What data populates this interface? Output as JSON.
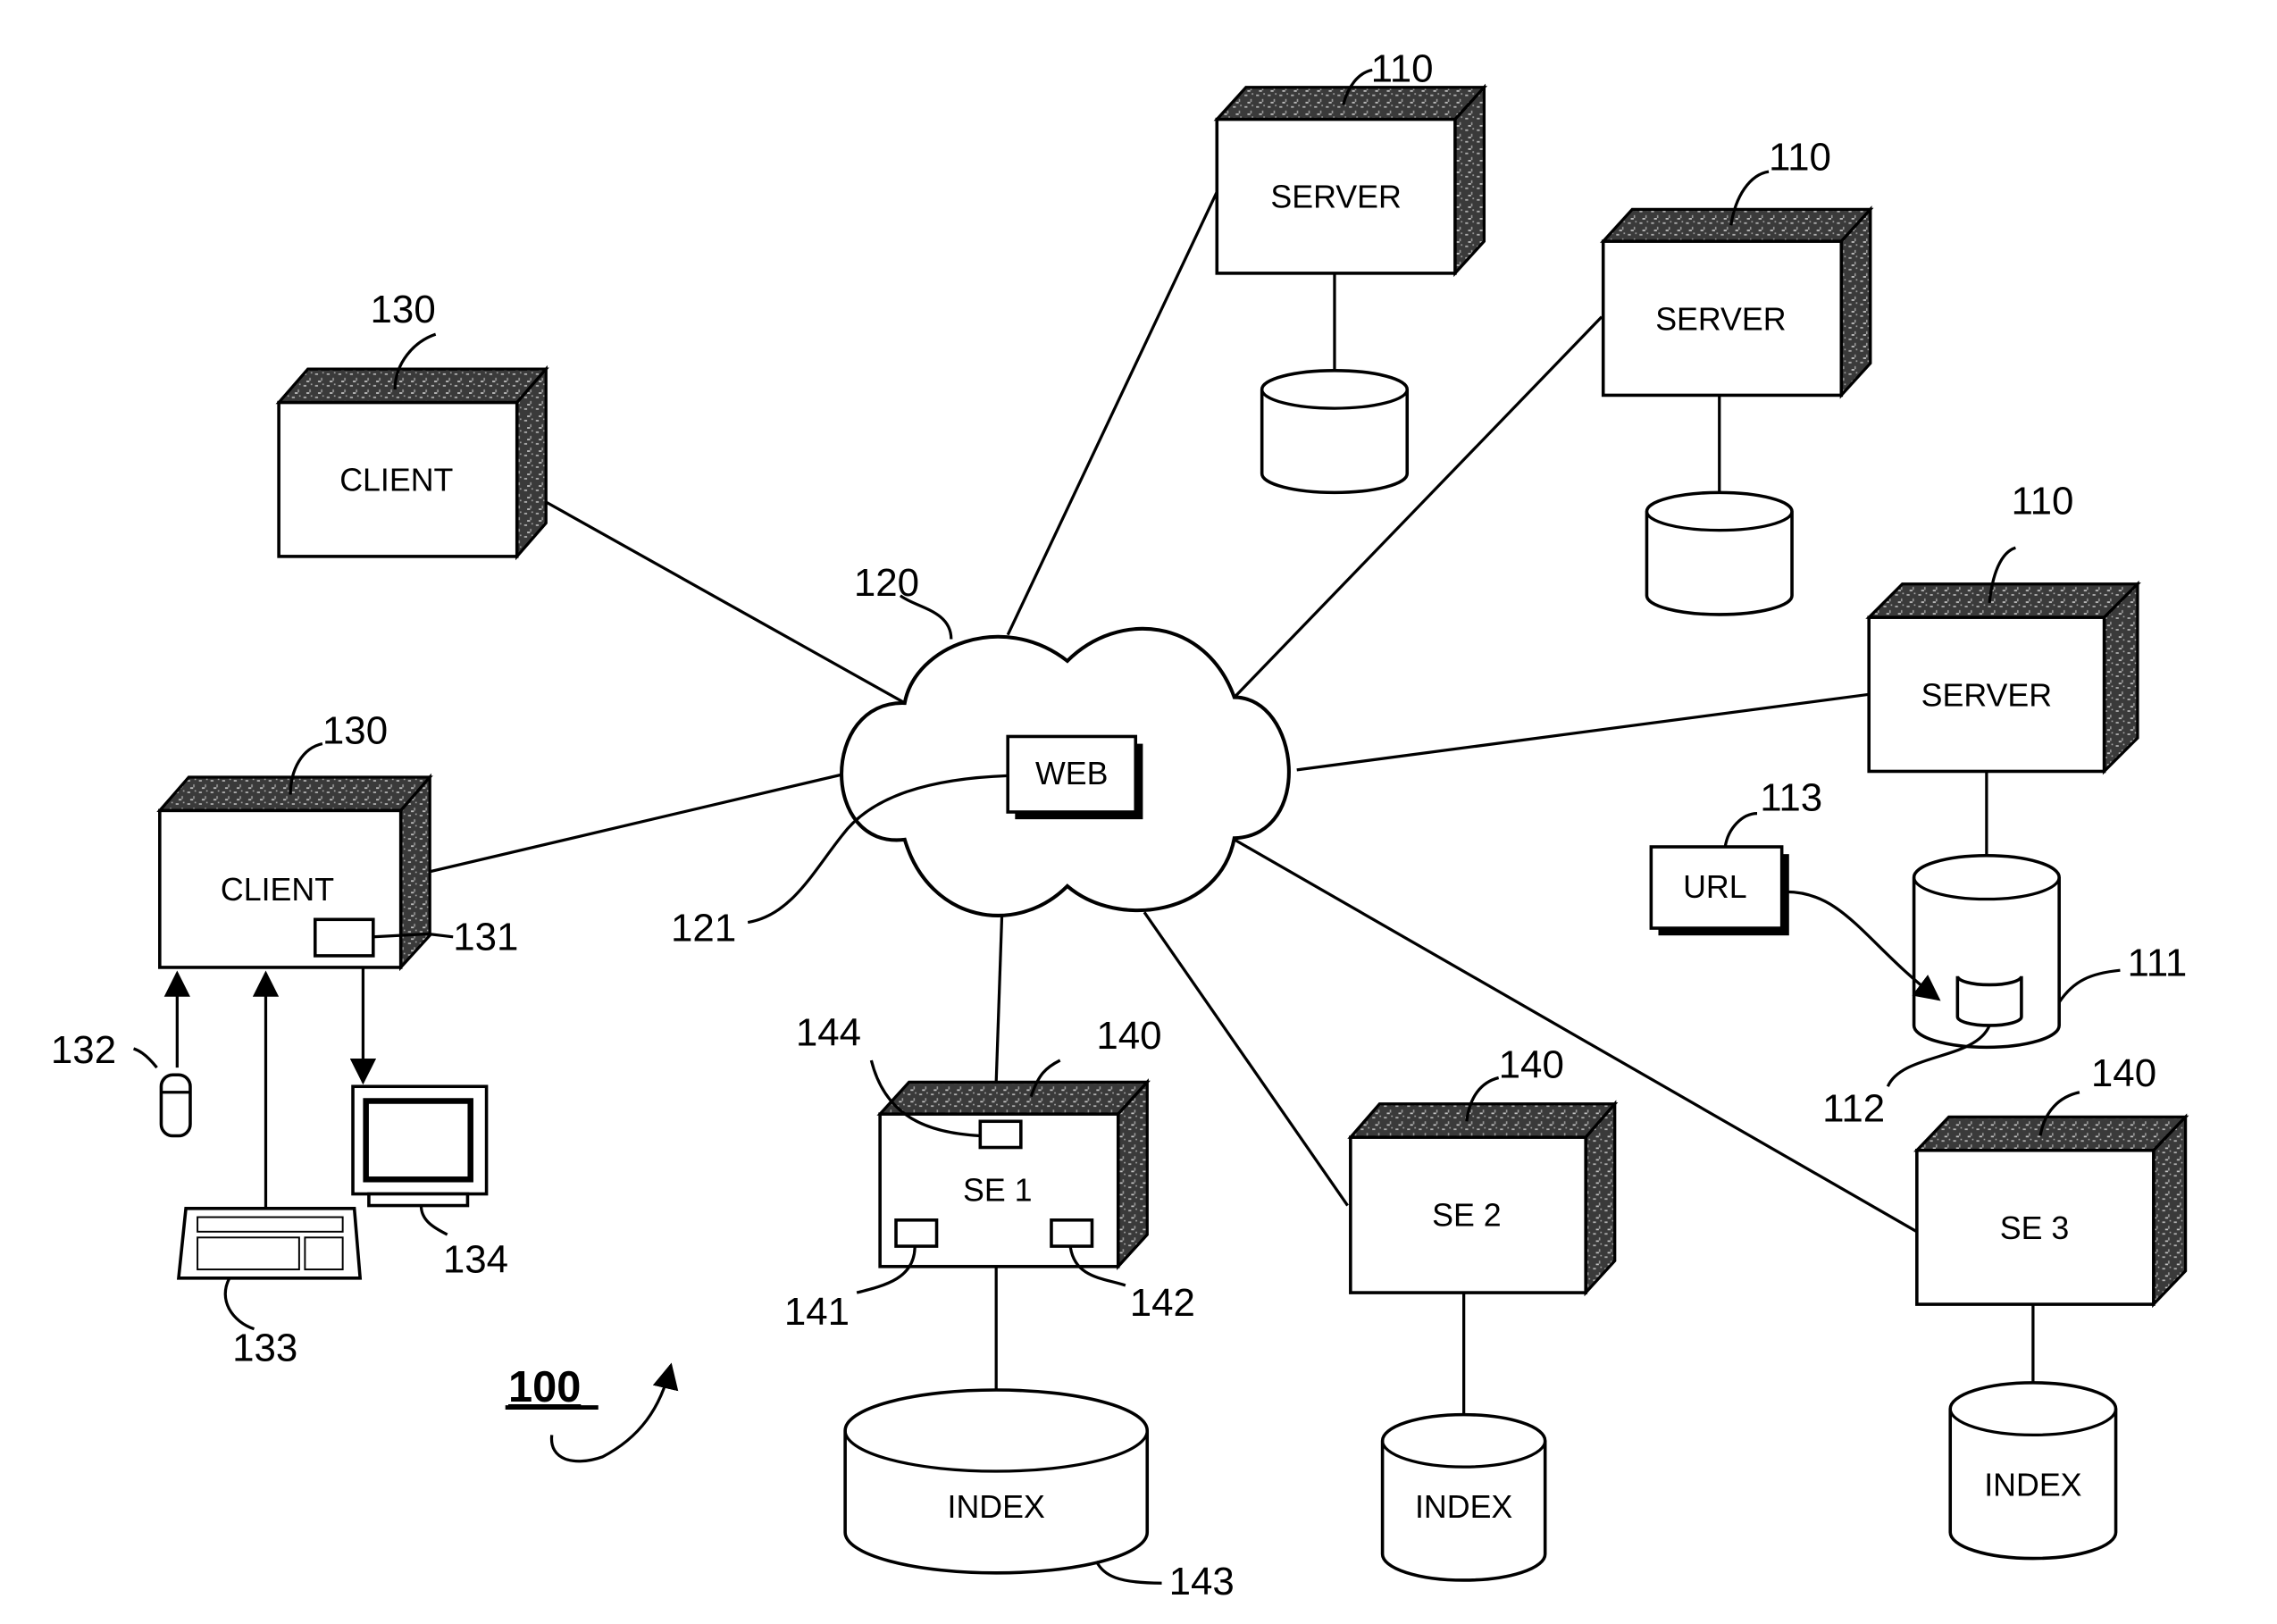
{
  "figure": {
    "number": "100",
    "network": {
      "ref": "120",
      "inner_label": "WEB",
      "inner_ref": "121"
    },
    "clients": [
      {
        "label": "CLIENT",
        "ref": "130"
      },
      {
        "label": "CLIENT",
        "ref": "130",
        "component_ref": "131"
      }
    ],
    "peripherals": {
      "mouse_ref": "132",
      "keyboard_ref": "133",
      "monitor_ref": "134"
    },
    "servers": [
      {
        "label": "SERVER",
        "ref": "110"
      },
      {
        "label": "SERVER",
        "ref": "110"
      },
      {
        "label": "SERVER",
        "ref": "110",
        "db_ref": "111",
        "doc_ref": "112",
        "url_label": "URL",
        "url_ref": "113"
      }
    ],
    "search_engines": [
      {
        "label": "SE 1",
        "ref": "140",
        "index_label": "INDEX",
        "index_ref": "143",
        "component_refs": [
          "141",
          "142",
          "144"
        ]
      },
      {
        "label": "SE 2",
        "ref": "140",
        "index_label": "INDEX"
      },
      {
        "label": "SE 3",
        "ref": "140",
        "index_label": "INDEX"
      }
    ]
  }
}
